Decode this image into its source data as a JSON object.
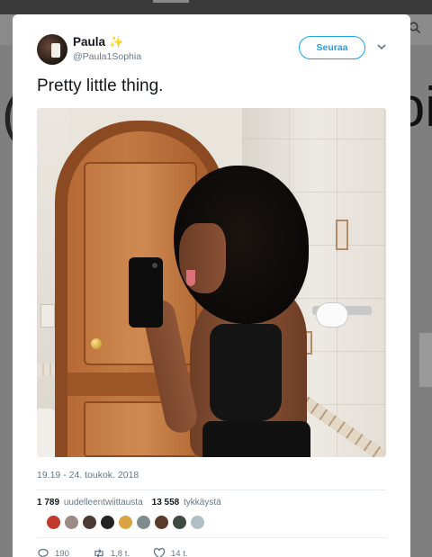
{
  "tweet": {
    "display_name": "Paula",
    "name_emoji": "✨",
    "handle": "@Paula1Sophia",
    "follow_label": "Seuraa",
    "text": "Pretty little thing.",
    "timestamp": "19.19 - 24. toukok. 2018",
    "retweets_count": "1 789",
    "retweets_label": "uudelleentwiittausta",
    "likes_count": "13 558",
    "likes_label": "tykkäystä",
    "actions": {
      "reply_count": "190",
      "retweet_count": "1,8 t.",
      "like_count": "14 t."
    },
    "liker_colors": [
      "#c0392b",
      "#9b8a86",
      "#4a3a33",
      "#222222",
      "#d9a441",
      "#7f8c8d",
      "#5b3a2e",
      "#3e4a3f",
      "#b0bec5"
    ]
  },
  "icons": {
    "sparkle": "sparkle-icon",
    "caret": "chevron-down-icon",
    "reply": "reply-icon",
    "retweet": "retweet-icon",
    "like": "heart-icon",
    "search": "search-icon"
  },
  "colors": {
    "accent": "#1da1f2",
    "secondary_text": "#657786"
  }
}
